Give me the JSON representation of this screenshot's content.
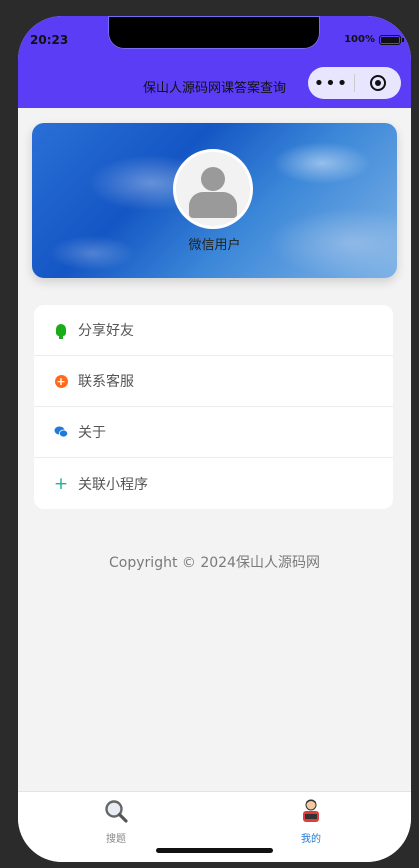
{
  "status_bar": {
    "time": "20:23",
    "battery": "100%"
  },
  "nav": {
    "title": "保山人源码网课答案查询",
    "more_icon": "more-dots-icon",
    "close_icon": "capsule-close-icon"
  },
  "colors": {
    "header_bg": "#5b3df5",
    "accent_blue": "#1f7ad8",
    "share_green": "#1aad19",
    "service_orange": "#ff6a1a",
    "link_teal": "#1ab29b"
  },
  "profile": {
    "username": "微信用户",
    "avatar_icon": "default-avatar-icon"
  },
  "menu": {
    "items": [
      {
        "label": "分享好友",
        "icon": "bulb-icon"
      },
      {
        "label": "联系客服",
        "icon": "plus-circle-icon"
      },
      {
        "label": "关于",
        "icon": "wechat-icon"
      },
      {
        "label": "关联小程序",
        "icon": "plus-icon"
      }
    ]
  },
  "footer": {
    "copyright": "Copyright © 2024保山人源码网"
  },
  "tabbar": {
    "items": [
      {
        "label": "搜题",
        "icon": "magnifier-icon",
        "active": false
      },
      {
        "label": "我的",
        "icon": "user-avatar-icon",
        "active": true
      }
    ]
  }
}
